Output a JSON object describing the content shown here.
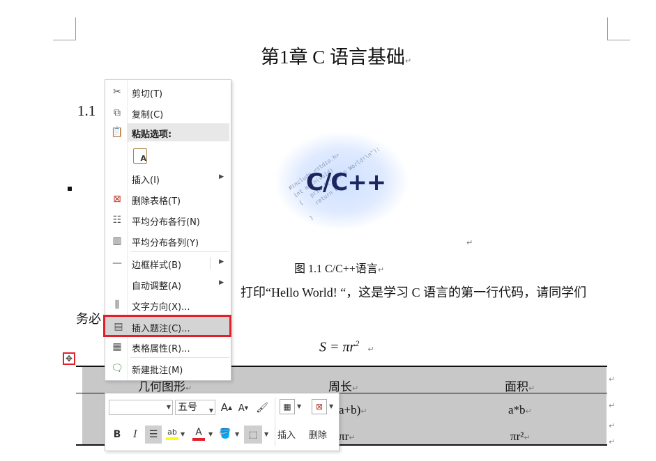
{
  "document": {
    "chapter_title": "第1章  C 语言基础",
    "para_mark": "↵",
    "section_heading": "1.1 ",
    "logo_text": "C/C++",
    "logo_code": "#include <stdio.h>\nint main(void)\n{   printf(\"Hello World!\\n\");\n    return 0;\n}",
    "figure_caption": "图 1.1 C/C++语言",
    "body_line1": "打印“Hello World! “，这是学习 C 语言的第一行代码，请同学们",
    "body_line2": "务必",
    "formula_lhs": "S",
    "formula_rhs": " = πr",
    "formula_exp": "2",
    "table_handle_glyph": "✥",
    "table": {
      "headers": [
        "几何图形",
        "周长",
        "面积"
      ],
      "row1": [
        "",
        "a+b)",
        "a*b"
      ],
      "row2": [
        "",
        "πr",
        "πr²"
      ]
    }
  },
  "context_menu": {
    "items": [
      {
        "label": "剪切(T)",
        "icon": "scissors-icon"
      },
      {
        "label": "复制(C)",
        "icon": "copy-icon"
      },
      {
        "label": "粘贴选项:",
        "icon": "clipboard-icon"
      },
      {
        "label": "",
        "icon": "paste-keep-text-icon"
      },
      {
        "label": "插入(I)",
        "icon": ""
      },
      {
        "label": "删除表格(T)",
        "icon": "delete-table-icon"
      },
      {
        "label": "平均分布各行(N)",
        "icon": "distribute-rows-icon"
      },
      {
        "label": "平均分布各列(Y)",
        "icon": "distribute-columns-icon"
      },
      {
        "label": "边框样式(B)",
        "icon": "border-style-icon"
      },
      {
        "label": "自动调整(A)",
        "icon": ""
      },
      {
        "label": "文字方向(X)...",
        "icon": "text-direction-icon"
      },
      {
        "label": "插入题注(C)...",
        "icon": "insert-caption-icon"
      },
      {
        "label": "表格属性(R)...",
        "icon": "table-properties-icon"
      },
      {
        "label": "新建批注(M)",
        "icon": "new-comment-icon"
      }
    ],
    "highlight_color": "#e3202a"
  },
  "mini_toolbar": {
    "font_name": "",
    "font_size": "五号",
    "grow_font": "A",
    "shrink_font": "A",
    "bold": "B",
    "italic": "I",
    "highlight_text": "ab",
    "font_color_text": "A",
    "insert_label": "插入",
    "delete_label": "删除",
    "font_color": "#e3202a",
    "highlight_color": "#ffff00"
  }
}
